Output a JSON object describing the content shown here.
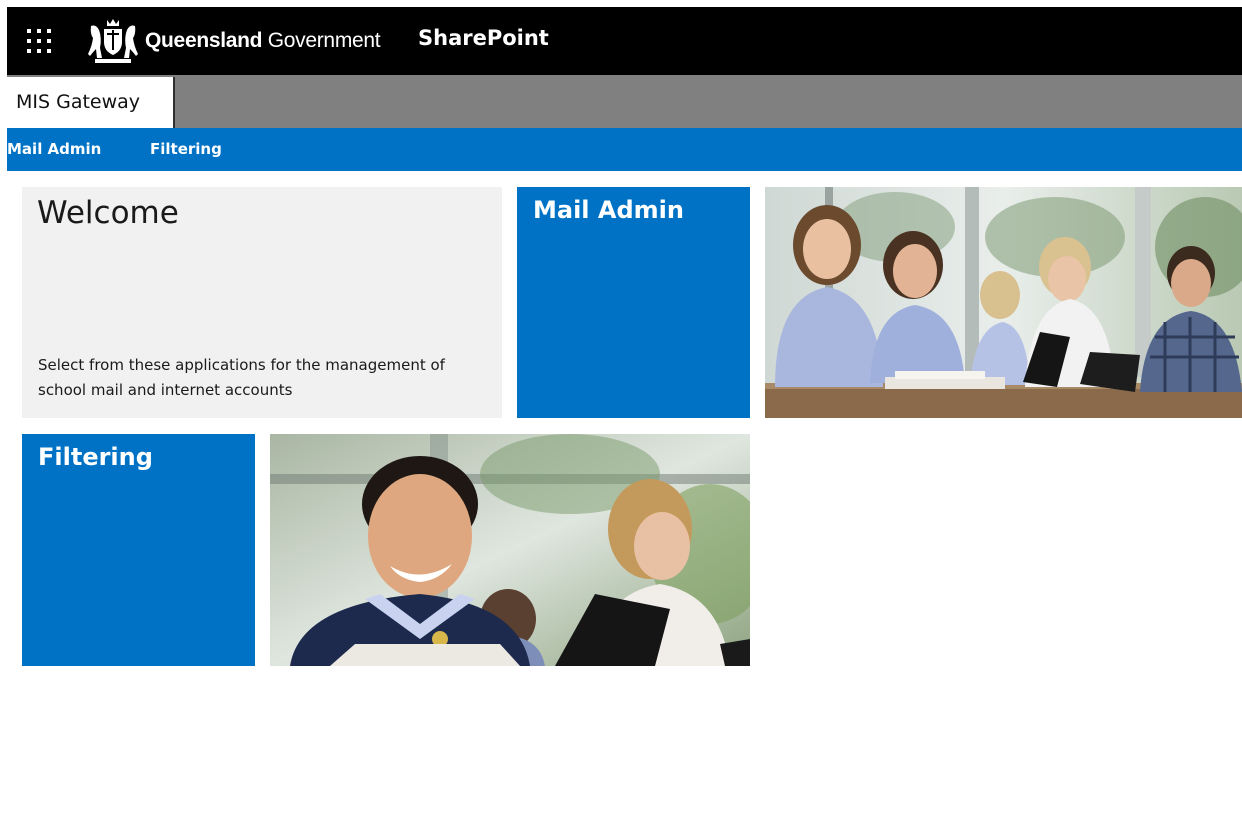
{
  "suite_bar": {
    "logo": {
      "brand_bold": "Queensland",
      "brand_light": "Government"
    },
    "app_name": "SharePoint"
  },
  "site": {
    "title": "MIS Gateway"
  },
  "nav": {
    "items": [
      {
        "label": "Mail Admin"
      },
      {
        "label": "Filtering"
      }
    ]
  },
  "tiles": {
    "welcome": {
      "title": "Welcome",
      "description": "Select from these applications for the management of school mail and internet accounts"
    },
    "mail_admin": {
      "label": "Mail Admin"
    },
    "filtering": {
      "label": "Filtering"
    }
  },
  "colors": {
    "suite_bar": "#000000",
    "site_header": "#808080",
    "nav_bar": "#0072c6",
    "tile_accent": "#0072c6",
    "welcome_bg": "#f1f1f1"
  },
  "icons": {
    "app_launcher": "waffle-icon",
    "logo": "queensland-crest-icon"
  }
}
